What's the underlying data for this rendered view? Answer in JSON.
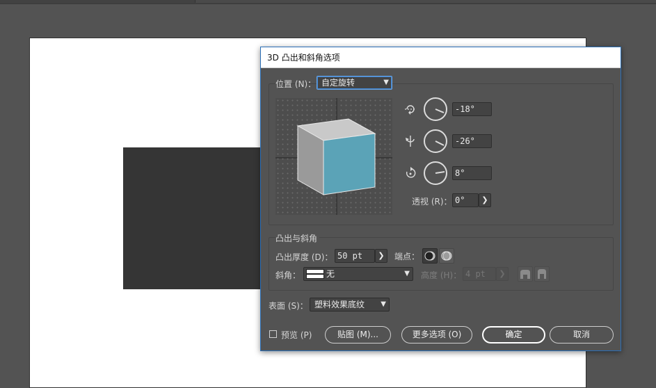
{
  "window": {
    "title": "3D 凸出和斜角选项"
  },
  "position": {
    "label": "位置 (N)：",
    "value": "自定旋转",
    "x_rotation": "-18°",
    "y_rotation": "-26°",
    "z_rotation": "8°",
    "perspective_label": "透视 (R)：",
    "perspective_value": "0°"
  },
  "extrude_bevel": {
    "group_title": "凸出与斜角",
    "depth_label": "凸出厚度 (D)：",
    "depth_value": "50 pt",
    "cap_label": "端点：",
    "bevel_label": "斜角：",
    "bevel_value": "无",
    "height_label": "高度 (H)：",
    "height_value": "4 pt"
  },
  "surface": {
    "label": "表面 (S)：",
    "value": "塑料效果底纹"
  },
  "footer": {
    "preview_label": "预览 (P)",
    "map_art_label": "贴图 (M)...",
    "more_options_label": "更多选项 (O)",
    "ok_label": "确定",
    "cancel_label": "取消"
  },
  "colors": {
    "cube_front": "#5ba3b7",
    "cube_top": "#c9c9c9",
    "cube_left": "#9a9a9a",
    "focus": "#2a6fb8"
  },
  "icons": [
    "x-axis-rotate-icon",
    "y-axis-rotate-icon",
    "z-axis-rotate-icon",
    "cap-on-icon",
    "cap-off-icon",
    "bevel-in-icon",
    "bevel-out-icon",
    "chevron-down-icon",
    "chevron-right-icon"
  ]
}
